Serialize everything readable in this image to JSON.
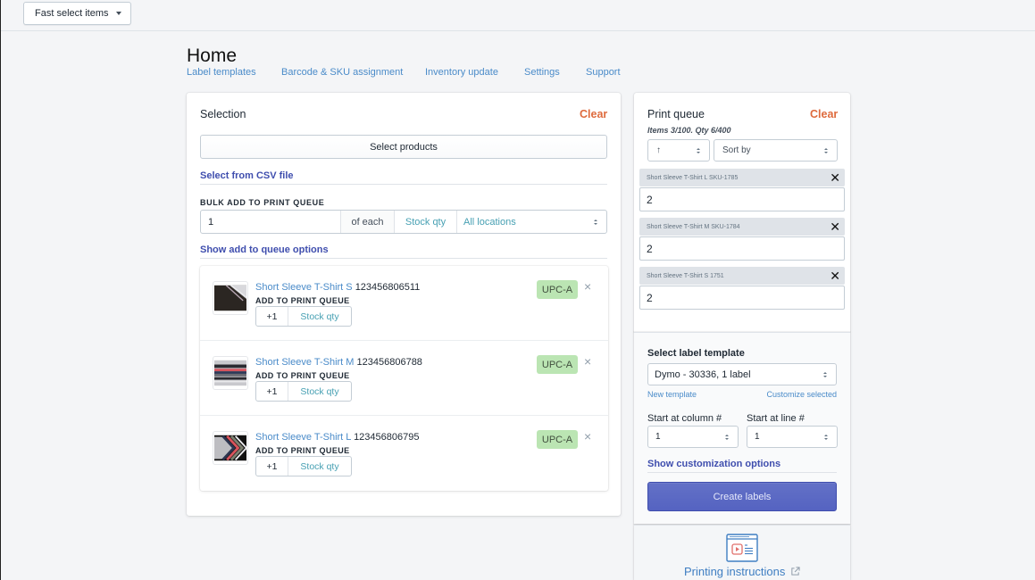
{
  "topbar": {
    "fast_select_label": "Fast select items"
  },
  "page": {
    "title": "Home",
    "nav": [
      {
        "label": "Label templates"
      },
      {
        "label": "Barcode & SKU assignment"
      },
      {
        "label": "Inventory update"
      },
      {
        "label": "Settings"
      },
      {
        "label": "Support"
      }
    ]
  },
  "selection": {
    "title": "Selection",
    "clear_label": "Clear",
    "select_products_label": "Select products",
    "csv_link": "Select from CSV file",
    "bulk_label": "BULK ADD TO PRINT QUEUE",
    "bulk_qty": "1",
    "bulk_of_each": "of each",
    "bulk_stock_qty": "Stock qty",
    "bulk_location": "All locations",
    "show_options_link": "Show add to queue options",
    "products": [
      {
        "name": "Short Sleeve T-Shirt S",
        "barcode": "123456806511",
        "add_label": "ADD TO PRINT QUEUE",
        "plus_label": "+1",
        "stock_label": "Stock qty",
        "badge": "UPC-A",
        "remove": "×"
      },
      {
        "name": "Short Sleeve T-Shirt M",
        "barcode": "123456806788",
        "add_label": "ADD TO PRINT QUEUE",
        "plus_label": "+1",
        "stock_label": "Stock qty",
        "badge": "UPC-A",
        "remove": "×"
      },
      {
        "name": "Short Sleeve T-Shirt L",
        "barcode": "123456806795",
        "add_label": "ADD TO PRINT QUEUE",
        "plus_label": "+1",
        "stock_label": "Stock qty",
        "badge": "UPC-A",
        "remove": "×"
      }
    ]
  },
  "queue": {
    "title": "Print queue",
    "clear_label": "Clear",
    "summary": "Items 3/100. Qty 6/400",
    "order_value": "↑",
    "sort_placeholder": "Sort by",
    "items": [
      {
        "label": "Short Sleeve T-Shirt L SKU-1785",
        "qty": "2",
        "remove": "✕"
      },
      {
        "label": "Short Sleeve T-Shirt M SKU-1784",
        "qty": "2",
        "remove": "✕"
      },
      {
        "label": "Short Sleeve T-Shirt S 1751",
        "qty": "2",
        "remove": "✕"
      }
    ]
  },
  "template": {
    "title": "Select label template",
    "selected": "Dymo - 30336, 1 label",
    "new_template_link": "New template",
    "customize_link": "Customize selected",
    "start_column_label": "Start at column #",
    "start_column_value": "1",
    "start_line_label": "Start at line #",
    "start_line_value": "1",
    "customization_link": "Show customization options",
    "create_button": "Create labels"
  },
  "help": {
    "printing_instructions": "Printing instructions"
  },
  "colors": {
    "accent": "#5c6ac4",
    "clear": "#de6a3c",
    "link": "#4a8bc9",
    "badge_bg": "#bbe5b3"
  }
}
